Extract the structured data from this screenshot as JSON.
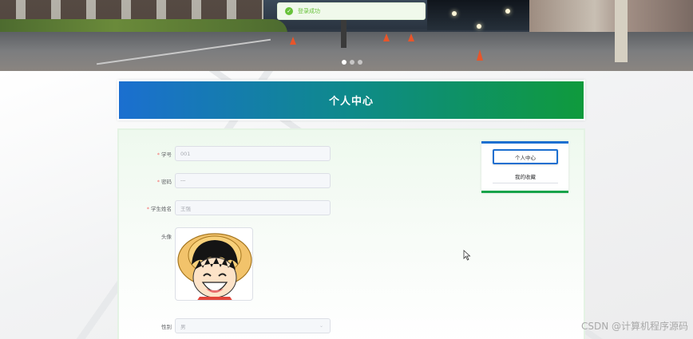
{
  "toast": {
    "icon": "success-check-icon",
    "message": "登录成功",
    "color": "#67c23a"
  },
  "carousel": {
    "slide_count": 3,
    "active_index": 0
  },
  "header": {
    "title": "个人中心"
  },
  "form": {
    "student_id": {
      "label": "学号",
      "required": true,
      "value": "001"
    },
    "password": {
      "label": "密码",
      "required": true,
      "value": "···"
    },
    "student_name": {
      "label": "学生姓名",
      "required": true,
      "value": "王强"
    },
    "avatar": {
      "label": "头像"
    },
    "gender": {
      "label": "性别",
      "value": "男"
    }
  },
  "side_menu": {
    "items": [
      {
        "label": "个人中心",
        "active": true
      },
      {
        "label": "我的收藏",
        "active": false
      }
    ]
  },
  "watermark": "CSDN @计算机程序源码",
  "colors": {
    "brand_blue": "#1b6fd0",
    "brand_green": "#0f9a3c",
    "required": "#f56c6c"
  }
}
